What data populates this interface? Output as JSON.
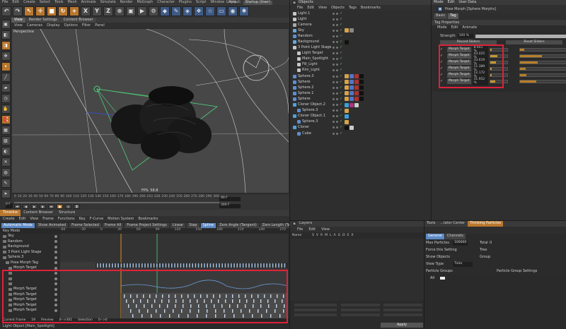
{
  "menubar": {
    "items": [
      "File",
      "Edit",
      "Create",
      "Select",
      "Tools",
      "Mesh",
      "Animate",
      "Simulate",
      "Render",
      "MoGraph",
      "Character",
      "Plugins",
      "Script",
      "Window",
      "Help"
    ],
    "layout_label": "Layout:",
    "layout_value": "Startup (User)"
  },
  "toolbar": {
    "buttons": [
      {
        "icon": "undo-icon",
        "glyph": "↶"
      },
      {
        "icon": "redo-icon",
        "glyph": "↷"
      },
      {
        "icon": "live-selection-icon",
        "glyph": "↖"
      },
      {
        "icon": "move-icon",
        "glyph": "✛"
      },
      {
        "icon": "scale-icon",
        "glyph": "■"
      },
      {
        "icon": "rotate-icon",
        "glyph": "↻"
      },
      {
        "icon": "last-tool-icon",
        "glyph": "+"
      },
      {
        "icon": "x-axis-icon",
        "glyph": "X"
      },
      {
        "icon": "y-axis-icon",
        "glyph": "Y"
      },
      {
        "icon": "z-axis-icon",
        "glyph": "Z"
      },
      {
        "icon": "coordinate-system-icon",
        "glyph": "⊕"
      },
      {
        "icon": "render-view-icon",
        "glyph": "▣"
      },
      {
        "icon": "render-picture-viewer-icon",
        "glyph": "▶"
      },
      {
        "icon": "edit-render-settings-icon",
        "glyph": "⚙"
      },
      {
        "icon": "cube-icon",
        "glyph": "◆"
      },
      {
        "icon": "pen-icon",
        "glyph": "✎"
      },
      {
        "icon": "subdivision-icon",
        "glyph": "◈"
      },
      {
        "icon": "array-icon",
        "glyph": "❖"
      },
      {
        "icon": "deformer-icon",
        "glyph": "☆"
      },
      {
        "icon": "floor-icon",
        "glyph": "▭"
      },
      {
        "icon": "camera-icon",
        "glyph": "◉"
      },
      {
        "icon": "light-icon",
        "glyph": "✺"
      }
    ]
  },
  "left_toolbar": {
    "buttons": [
      "make-editable-icon",
      "model-mode-icon",
      "texture-mode-icon",
      "axis-mode-icon",
      "points-mode-icon",
      "edges-mode-icon",
      "polygons-mode-icon",
      "animation-mode-icon",
      "tweak-icon",
      "snap-icon",
      "workplane-icon",
      "locked-workplane-icon",
      "solo-icon",
      "xref-icon",
      "sculpt-icon",
      "bodypaint-icon",
      "motion-icon"
    ]
  },
  "viewport": {
    "tabs": [
      "View",
      "Render Settings",
      "Content Browser"
    ],
    "active_tab": "View",
    "menu": [
      "View",
      "Cameras",
      "Display",
      "Options",
      "Filter",
      "Panel"
    ],
    "label": "Perspective",
    "fps_label": "FPS:",
    "fps_value": "58.8"
  },
  "timeline_strip": {
    "ticks": [
      "0",
      "10",
      "20",
      "30",
      "40",
      "50",
      "60",
      "70",
      "80",
      "90",
      "100",
      "110",
      "120",
      "130",
      "140",
      "150",
      "160",
      "170",
      "180",
      "190",
      "200",
      "210",
      "220",
      "230",
      "240",
      "250",
      "260",
      "270",
      "280",
      "290",
      "300"
    ],
    "end_frame": "90 F",
    "current_frame": "0 F",
    "end_frame_2": "300 F"
  },
  "bottom_panel": {
    "tabs": [
      "Timeline",
      "Content Browser",
      "Structure"
    ],
    "active_tab": "Timeline",
    "menu": [
      "Create",
      "Edit",
      "View",
      "Frame",
      "Functions",
      "Key",
      "F-Curve",
      "Motion System",
      "Bookmarks"
    ],
    "buttons": [
      "Automatic Mode",
      "Show Animated",
      "Frame Selected",
      "Frame All",
      "Frame Project Settings",
      "Linear",
      "Step",
      "Spline",
      "Zero Angle (Tangent)",
      "Zero Length (Tangent)",
      "Clamp"
    ],
    "active_button": "Spline",
    "key_mode": "Key Mode",
    "ruler": [
      "-60",
      "-30",
      "0",
      "30",
      "60",
      "90",
      "120",
      "150",
      "180",
      "210",
      "240",
      "270"
    ],
    "tree": [
      {
        "name": "Sky",
        "indent": 0
      },
      {
        "name": "Random",
        "indent": 0
      },
      {
        "name": "Background",
        "indent": 0
      },
      {
        "name": "3 Point Light Stage",
        "indent": 0
      },
      {
        "name": "Sphere.3",
        "indent": 0
      },
      {
        "name": "Pose Morph Tag",
        "indent": 1
      },
      {
        "name": "Morph Target",
        "indent": 2
      },
      {
        "name": "",
        "indent": 2
      },
      {
        "name": "",
        "indent": 2
      },
      {
        "name": "",
        "indent": 2
      },
      {
        "name": "Morph Target",
        "indent": 2
      },
      {
        "name": "Morph Target",
        "indent": 2
      },
      {
        "name": "Morph Target",
        "indent": 2
      },
      {
        "name": "Morph Target",
        "indent": 2
      },
      {
        "name": "Morph Target",
        "indent": 2
      }
    ],
    "status": {
      "current_frame_label": "Current Frame",
      "current_frame": "59",
      "preview_label": "Preview",
      "preview": "0-->301",
      "selection_label": "Selection",
      "selection": "0-->0"
    },
    "status_message": "Light Object [Main_Spotlight]"
  },
  "objects": {
    "title": "Objects",
    "menu": [
      "File",
      "Edit",
      "View",
      "Objects",
      "Tags",
      "Bookmarks"
    ],
    "rows": [
      {
        "name": "Light.1",
        "indent": 0,
        "icon_color": "#c7c7c7",
        "tags": []
      },
      {
        "name": "Light",
        "indent": 0,
        "icon_color": "#c7c7c7",
        "tags": []
      },
      {
        "name": "Camera",
        "indent": 0,
        "icon_color": "#aaaaaa",
        "tags": []
      },
      {
        "name": "Sky",
        "indent": 0,
        "icon_color": "#6aa7d9",
        "tags": [
          "#d6a24a",
          "#888888"
        ]
      },
      {
        "name": "Random",
        "indent": 0,
        "icon_color": "#5e8fd1",
        "tags": []
      },
      {
        "name": "Background",
        "indent": 0,
        "icon_color": "#6aa7d9",
        "tags": [
          "#111111"
        ]
      },
      {
        "name": "3 Point Light Stage",
        "indent": 0,
        "icon_color": "#c7c7c7",
        "tags": []
      },
      {
        "name": "Light Target",
        "indent": 1,
        "icon_color": "#c7c7c7",
        "tags": []
      },
      {
        "name": "Main_Spotlight",
        "indent": 1,
        "icon_color": "#c7c7c7",
        "tags": []
      },
      {
        "name": "Fill_Light",
        "indent": 1,
        "icon_color": "#c7c7c7",
        "tags": []
      },
      {
        "name": "Rim_Light",
        "indent": 1,
        "icon_color": "#c7c7c7",
        "tags": []
      },
      {
        "name": "Sphere.3",
        "indent": 0,
        "icon_color": "#5e8fd1",
        "tags": [
          "#d6a24a",
          "#4f77c9",
          "#b03030",
          "#111111"
        ]
      },
      {
        "name": "Sphere",
        "indent": 0,
        "icon_color": "#5e8fd1",
        "tags": [
          "#d6a24a",
          "#4f77c9",
          "#b03030",
          "#111111"
        ]
      },
      {
        "name": "Sphere.2",
        "indent": 0,
        "icon_color": "#5e8fd1",
        "tags": [
          "#d6a24a",
          "#4f77c9",
          "#b03030",
          "#111111"
        ]
      },
      {
        "name": "Sphere.1",
        "indent": 0,
        "icon_color": "#5e8fd1",
        "tags": [
          "#d6a24a",
          "#4f77c9",
          "#b03030",
          "#111111"
        ]
      },
      {
        "name": "Sphere",
        "indent": 0,
        "icon_color": "#5e8fd1",
        "tags": [
          "#d6a24a",
          "#4f77c9",
          "#b03030",
          "#111111"
        ]
      },
      {
        "name": "Cloner Object.2",
        "indent": 0,
        "icon_color": "#4fa3d9",
        "tags": [
          "#3aa0d8",
          "#b03080",
          "#cccccc"
        ]
      },
      {
        "name": "Sphere.3",
        "indent": 1,
        "icon_color": "#5e8fd1",
        "tags": [
          "#d6a24a"
        ]
      },
      {
        "name": "Cloner Object.1",
        "indent": 0,
        "icon_color": "#4fa3d9",
        "tags": [
          "#3aa0d8"
        ]
      },
      {
        "name": "Sphere.3",
        "indent": 1,
        "icon_color": "#5e8fd1",
        "tags": [
          "#d6a24a"
        ]
      },
      {
        "name": "Cloner",
        "indent": 0,
        "icon_color": "#4fa3d9",
        "tags": [
          "#111111",
          "#cccccc"
        ]
      },
      {
        "name": "Cube",
        "indent": 1,
        "icon_color": "#5e8fd1",
        "tags": []
      }
    ]
  },
  "attributes": {
    "menu": [
      "Mode",
      "Edit",
      "User Data"
    ],
    "object_name": "Pose Morph [Sphere Morphs]",
    "tabs": [
      "Basic",
      "Tag"
    ],
    "active_tab": "Tag",
    "section": "Tag Properties",
    "mode_items": [
      "Mode",
      "Edit",
      "Animate"
    ],
    "strength_label": "Strength",
    "strength_value": "100 %",
    "strength_fraction": 1.0,
    "record_label": "Record Sliders",
    "reset_label": "Reset Sliders",
    "morph_targets": [
      {
        "label": "Morph Target",
        "value": "8.641 %",
        "fraction": 0.08641
      },
      {
        "label": "Morph Target",
        "value": "43.025 %",
        "fraction": 0.43025
      },
      {
        "label": "Morph Target",
        "value": "33.619 %",
        "fraction": 0.33619
      },
      {
        "label": "Morph Target",
        "value": "11.389 %",
        "fraction": 0.11389
      },
      {
        "label": "Morph Target",
        "value": "12.172 %",
        "fraction": 0.12172
      },
      {
        "label": "Morph Target",
        "value": "31.952 %",
        "fraction": 0.31952
      }
    ]
  },
  "layers": {
    "title": "Layers",
    "menu": [
      "File",
      "Edit",
      "View"
    ],
    "columns": [
      "Name",
      "S",
      "V",
      "R",
      "M",
      "L",
      "A",
      "G",
      "D",
      "E",
      "X"
    ],
    "apply_label": "Apply"
  },
  "particles": {
    "tabs": [
      "Tools",
      "...lator Center",
      "Thinking Particles"
    ],
    "active_tab": "Thinking Particles",
    "sub_tabs": [
      "General",
      "Channels"
    ],
    "active_sub_tab": "General",
    "max_particles_label": "Max Particles",
    "max_particles_value": "100000",
    "total_label": "Total",
    "total_value": "0",
    "force_label": "Force this Setting",
    "tree_label": "Tree",
    "show_objects_label": "Show Objects",
    "group_label": "Group",
    "view_type_label": "View Type",
    "view_type_value": "Ticks",
    "particle_groups_label": "Particle Groups",
    "all_label": "All",
    "group_settings_label": "Particle Group Settings"
  },
  "colors": {
    "accent_orange": "#b9772e",
    "selection_blue": "#5d8ac6",
    "highlight_red": "#e0213a",
    "slider_gold": "#c7972d"
  }
}
